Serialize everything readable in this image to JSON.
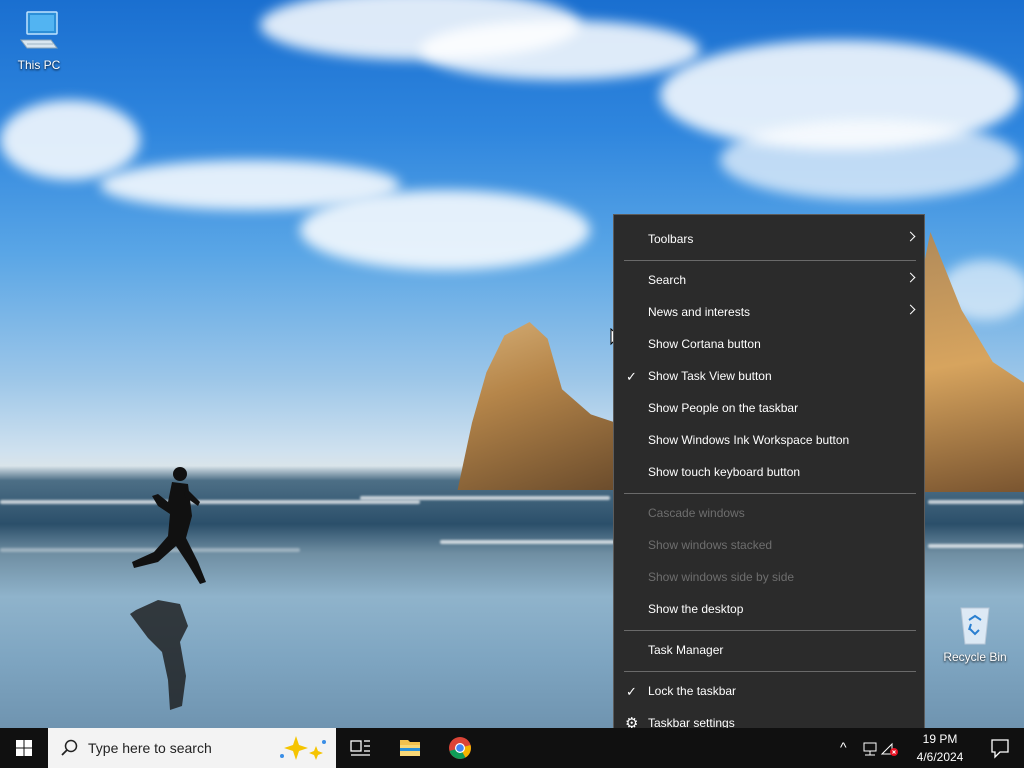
{
  "desktop": {
    "icons": [
      {
        "label": "This PC"
      },
      {
        "label": "Recycle Bin"
      }
    ]
  },
  "context_menu": {
    "items": [
      {
        "label": "Toolbars",
        "submenu": true,
        "checked": false,
        "enabled": true
      },
      {
        "label": "Search",
        "submenu": true,
        "checked": false,
        "enabled": true
      },
      {
        "label": "News and interests",
        "submenu": true,
        "checked": false,
        "enabled": true
      },
      {
        "label": "Show Cortana button",
        "submenu": false,
        "checked": false,
        "enabled": true
      },
      {
        "label": "Show Task View button",
        "submenu": false,
        "checked": true,
        "enabled": true
      },
      {
        "label": "Show People on the taskbar",
        "submenu": false,
        "checked": false,
        "enabled": true
      },
      {
        "label": "Show Windows Ink Workspace button",
        "submenu": false,
        "checked": false,
        "enabled": true
      },
      {
        "label": "Show touch keyboard button",
        "submenu": false,
        "checked": false,
        "enabled": true
      },
      {
        "label": "Cascade windows",
        "submenu": false,
        "checked": false,
        "enabled": false
      },
      {
        "label": "Show windows stacked",
        "submenu": false,
        "checked": false,
        "enabled": false
      },
      {
        "label": "Show windows side by side",
        "submenu": false,
        "checked": false,
        "enabled": false
      },
      {
        "label": "Show the desktop",
        "submenu": false,
        "checked": false,
        "enabled": true
      },
      {
        "label": "Task Manager",
        "submenu": false,
        "checked": false,
        "enabled": true
      },
      {
        "label": "Lock the taskbar",
        "submenu": false,
        "checked": true,
        "enabled": true
      },
      {
        "label": "Taskbar settings",
        "submenu": false,
        "checked": false,
        "enabled": true,
        "icon": "gear-icon"
      }
    ],
    "check_glyph": "✓",
    "gear_glyph": "⚙"
  },
  "taskbar": {
    "search_placeholder": "Type here to search",
    "pinned": [
      "task-view-icon",
      "file-explorer-icon",
      "chrome-icon"
    ],
    "tray_chevron": "^",
    "time": "19 PM",
    "date": "4/6/2024"
  },
  "colors": {
    "taskbar": "#101010",
    "menu_bg": "#2b2b2b",
    "menu_disabled_text": "#6e6e6e",
    "start_blue": "#ffffff"
  }
}
